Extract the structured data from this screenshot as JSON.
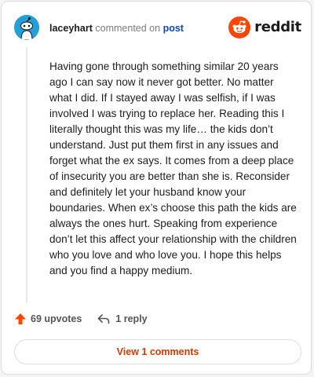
{
  "header": {
    "username": "laceyhart",
    "verb": "commented on",
    "post_link": "post",
    "brand": "reddit",
    "brand_color": "#ff4500"
  },
  "avatar": {
    "icon": "snoo-avatar-icon",
    "color": "#24a0d8"
  },
  "comment": {
    "body": "Having gone through something similar 20 years ago I can say now it never got better. No matter what I did. If I stayed away I was selfish, if I was involved I was trying to replace her. Reading this I literally thought this was my life… the kids don’t understand. Just put them first in any issues and forget what the ex says. It comes from a deep place of insecurity you are better than she is. Reconsider and definitely let your husband know your boundaries. When ex’s choose this path the kids are always the ones hurt. Speaking from experience don’t let this affect your relationship with the children who you love and who love you. I hope this helps and you find a happy medium."
  },
  "actions": {
    "upvotes": "69 upvotes",
    "replies": "1 reply",
    "view_comments": "View 1 comments"
  }
}
